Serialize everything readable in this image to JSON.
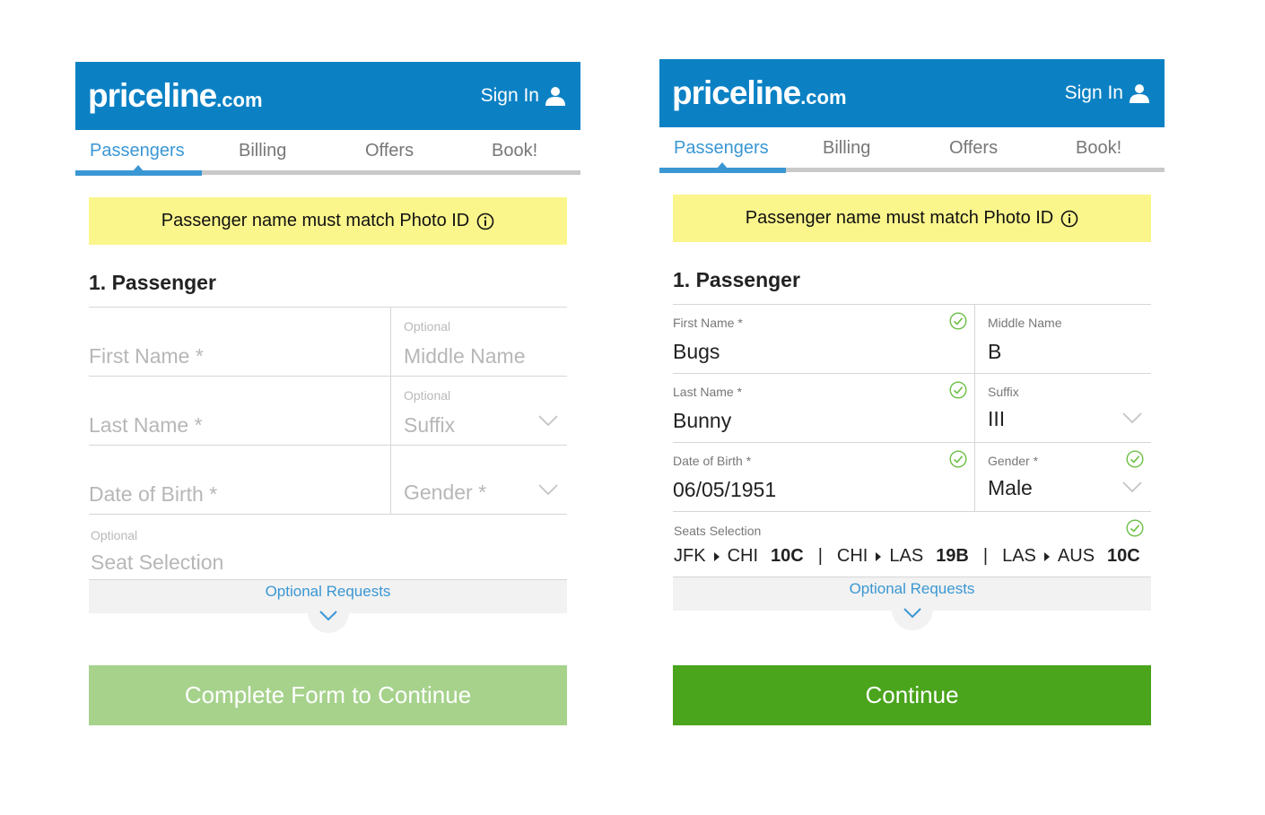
{
  "colors": {
    "brand": "#0b81c4",
    "tab_active": "#3a97d3",
    "notice_bg": "#fbf68c",
    "cta_disabled": "#a6d28c",
    "cta_enabled": "#4aa41c",
    "check": "#6cbf45"
  },
  "icons": [
    "user-icon",
    "info-icon",
    "chevron-down-icon",
    "check-circle-icon",
    "triangle-right-icon"
  ],
  "screens": {
    "a": {
      "logo": {
        "main": "priceline",
        "tld": ".com"
      },
      "signin": "Sign In",
      "tabs": [
        {
          "label": "Passengers",
          "active": true
        },
        {
          "label": "Billing"
        },
        {
          "label": "Offers"
        },
        {
          "label": "Book!"
        }
      ],
      "notice": "Passenger name must match Photo ID",
      "section_title": "1. Passenger",
      "fields": {
        "first_name": "First Name *",
        "middle_optional": "Optional",
        "middle_name": "Middle Name",
        "last_name": "Last Name *",
        "suffix_optional": "Optional",
        "suffix": "Suffix",
        "dob": "Date of Birth *",
        "gender": "Gender *",
        "seat_optional": "Optional",
        "seat": "Seat Selection"
      },
      "optional_requests": "Optional Requests",
      "cta": "Complete Form to Continue"
    },
    "b": {
      "logo": {
        "main": "priceline",
        "tld": ".com"
      },
      "signin": "Sign In",
      "tabs": [
        {
          "label": "Passengers",
          "active": true
        },
        {
          "label": "Billing"
        },
        {
          "label": "Offers"
        },
        {
          "label": "Book!"
        }
      ],
      "notice": "Passenger name must match Photo ID",
      "section_title": "1. Passenger",
      "fields": {
        "first_name_label": "First Name *",
        "first_name_value": "Bugs",
        "middle_name_label": "Middle Name",
        "middle_name_value": "B",
        "last_name_label": "Last Name *",
        "last_name_value": "Bunny",
        "suffix_label": "Suffix",
        "suffix_value": "III",
        "dob_label": "Date of Birth *",
        "dob_value": "06/05/1951",
        "gender_label": "Gender *",
        "gender_value": "Male",
        "seats_label": "Seats Selection"
      },
      "seats": [
        {
          "from": "JFK",
          "to": "CHI",
          "seat": "10C"
        },
        {
          "from": "CHI",
          "to": "LAS",
          "seat": "19B"
        },
        {
          "from": "LAS",
          "to": "AUS",
          "seat": "10C"
        }
      ],
      "separator": "|",
      "optional_requests": "Optional Requests",
      "cta": "Continue"
    }
  }
}
